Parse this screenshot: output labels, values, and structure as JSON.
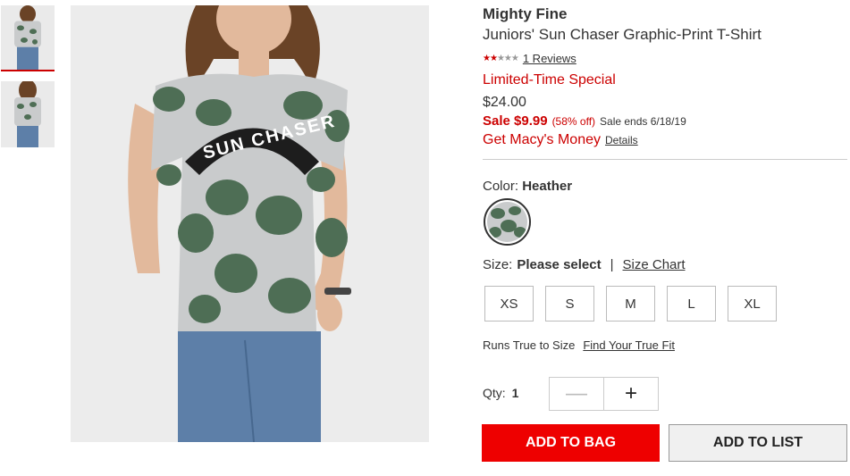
{
  "product": {
    "brand": "Mighty Fine",
    "title": "Juniors' Sun Chaser Graphic-Print T-Shirt",
    "rating": 2,
    "rating_max": 5,
    "reviews_link": "1 Reviews"
  },
  "pricing": {
    "promo": "Limited-Time Special",
    "original": "$24.00",
    "sale_price": "Sale $9.99",
    "discount": "(58% off)",
    "sale_ends": "Sale ends 6/18/19",
    "macys_money": "Get Macy's Money",
    "details_link": "Details"
  },
  "color": {
    "label": "Color:",
    "value": "Heather"
  },
  "size": {
    "label": "Size:",
    "value": "Please select",
    "separator": "|",
    "chart_link": "Size Chart",
    "options": [
      "XS",
      "S",
      "M",
      "L",
      "XL"
    ],
    "fit_text": "Runs True to Size",
    "fit_link": "Find Your True Fit"
  },
  "quantity": {
    "label": "Qty:",
    "value": "1",
    "minus": "—",
    "plus": "+"
  },
  "actions": {
    "add_to_bag": "ADD TO BAG",
    "add_to_list": "ADD TO LIST"
  },
  "image": {
    "shirt_text": "SUN CHASER",
    "colors": {
      "shirt": "#c9cbcc",
      "leaf": "#4e6e55",
      "band": "#1d1d1d",
      "jeans": "#5d7fa8",
      "skin": "#e2b99c",
      "hair": "#6a4326"
    }
  },
  "theme": {
    "sale_red": "#cc0000",
    "bag_red": "#ee0000"
  }
}
